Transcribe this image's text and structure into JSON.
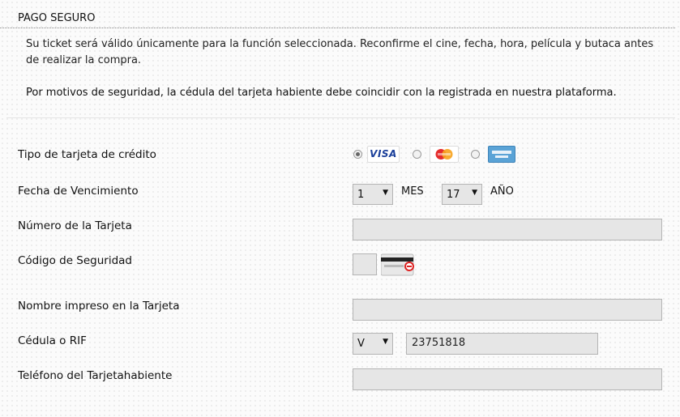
{
  "header": {
    "title": "PAGO SEGURO"
  },
  "notice": {
    "line1": "Su ticket será válido únicamente para la función seleccionada. Reconfirme el cine, fecha, hora, película y butaca antes de realizar la compra.",
    "line2": "Por motivos de seguridad, la cédula del tarjeta habiente debe coincidir con la registrada en nuestra plataforma."
  },
  "form": {
    "card_type_label": "Tipo de tarjeta de crédito",
    "card_options": [
      {
        "name": "VISA",
        "selected": true
      },
      {
        "name": "MasterCard",
        "selected": false
      },
      {
        "name": "American Express",
        "selected": false
      }
    ],
    "expiry_label": "Fecha de Vencimiento",
    "expiry_month": "1",
    "expiry_month_unit": "MES",
    "expiry_year": "17",
    "expiry_year_unit": "AÑO",
    "card_number_label": "Número de la Tarjeta",
    "card_number_value": "",
    "security_code_label": "Código de Seguridad",
    "security_code_value": "",
    "name_label": "Nombre impreso en la Tarjeta",
    "name_value": "",
    "id_label": "Cédula o RIF",
    "id_type": "V",
    "id_value": "23751818",
    "phone_label": "Teléfono del Tarjetahabiente",
    "phone_value": ""
  }
}
